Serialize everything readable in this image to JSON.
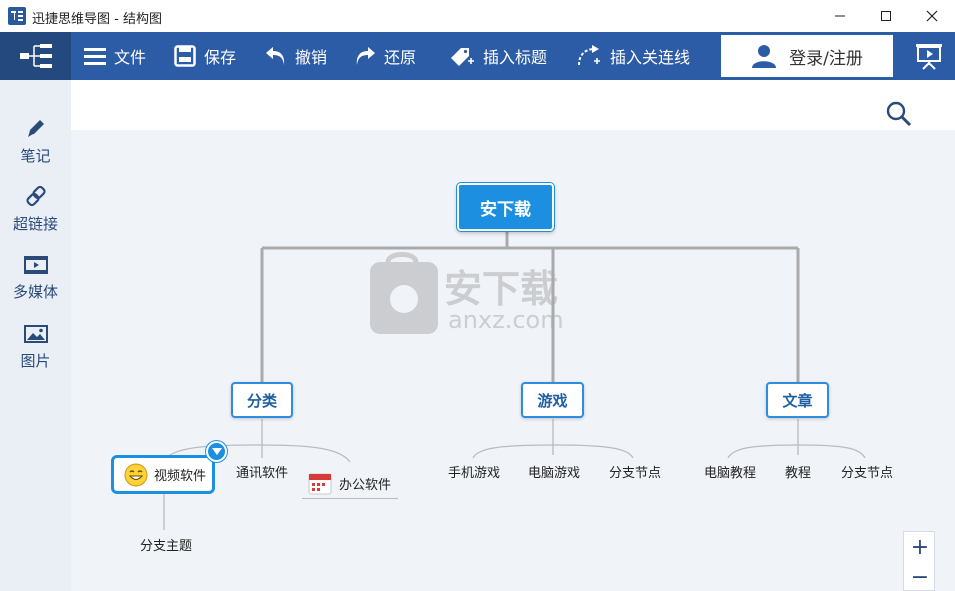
{
  "window": {
    "title": "迅捷思维导图 - 结构图"
  },
  "toolbar": {
    "file_label": "文件",
    "save_label": "保存",
    "undo_label": "撤销",
    "redo_label": "还原",
    "insert_title_label": "插入标题",
    "insert_link_label": "插入关连线",
    "login_label": "登录/注册"
  },
  "sidebar": {
    "items": [
      {
        "label": "笔记",
        "icon": "pencil-icon"
      },
      {
        "label": "超链接",
        "icon": "link-icon"
      },
      {
        "label": "多媒体",
        "icon": "film-icon"
      },
      {
        "label": "图片",
        "icon": "image-icon"
      }
    ]
  },
  "mindmap": {
    "root": "安下载",
    "branches": [
      {
        "label": "分类",
        "children": [
          "视频软件",
          "通讯软件",
          "办公软件"
        ],
        "sub": "分支主题"
      },
      {
        "label": "游戏",
        "children": [
          "手机游戏",
          "电脑游戏",
          "分支节点"
        ]
      },
      {
        "label": "文章",
        "children": [
          "电脑教程",
          "教程",
          "分支节点"
        ]
      }
    ]
  },
  "watermark": {
    "text_cn": "安下载",
    "text_en": "anxz.com"
  },
  "zoom": {
    "in_symbol": "+",
    "out_symbol": "−"
  },
  "colors": {
    "toolbar": "#2d5ca6",
    "accent": "#1c8fe0",
    "sidebar": "#eaeff6",
    "canvas": "#f0f3f8"
  }
}
